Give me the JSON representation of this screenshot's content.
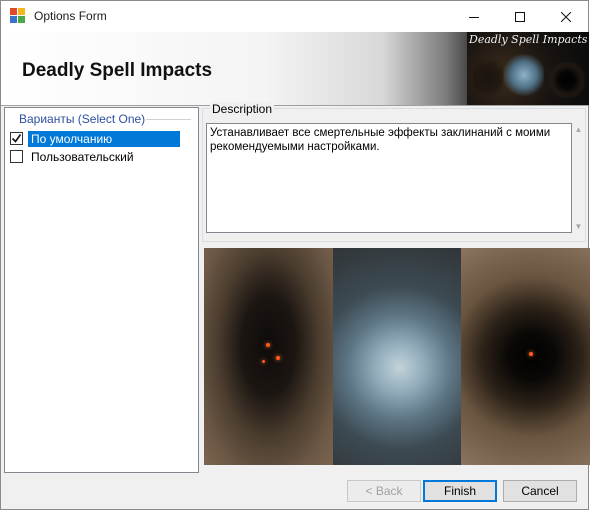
{
  "window": {
    "title": "Options Form",
    "controls": {
      "minimize": "minimize-icon",
      "maximize": "maximize-icon",
      "close": "close-icon"
    }
  },
  "banner": {
    "title": "Deadly Spell Impacts",
    "image_caption": "Deadly Spell Impacts"
  },
  "options": {
    "legend": "Варианты (Select One)",
    "items": [
      {
        "label": "По умолчанию",
        "checked": true,
        "selected": true
      },
      {
        "label": "Пользовательский",
        "checked": false,
        "selected": false
      }
    ]
  },
  "description": {
    "legend": "Description",
    "text": "Устанавливает все смертельные эффекты заклинаний с моими рекомендуемыми настройками."
  },
  "buttons": {
    "back": "< Back",
    "back_enabled": false,
    "finish": "Finish",
    "cancel": "Cancel"
  },
  "colors": {
    "accent": "#0078d7",
    "legend_blue": "#2d4fa0",
    "window_bg": "#f0f0f0"
  }
}
